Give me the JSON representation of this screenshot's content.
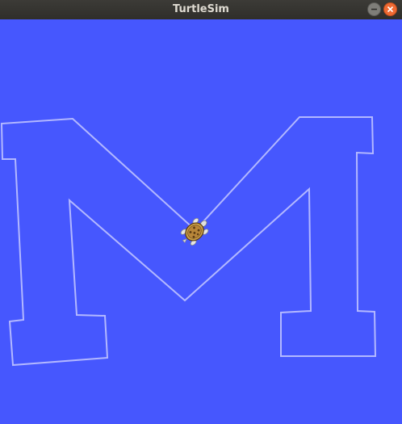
{
  "window": {
    "title": "TurtleSim"
  },
  "controls": {
    "minimize_icon": "minimize-icon",
    "close_icon": "close-icon"
  },
  "canvas": {
    "background_color": "#4657fe",
    "pen_color": "#b3b8ff",
    "turtle_icon": "turtle-icon"
  }
}
